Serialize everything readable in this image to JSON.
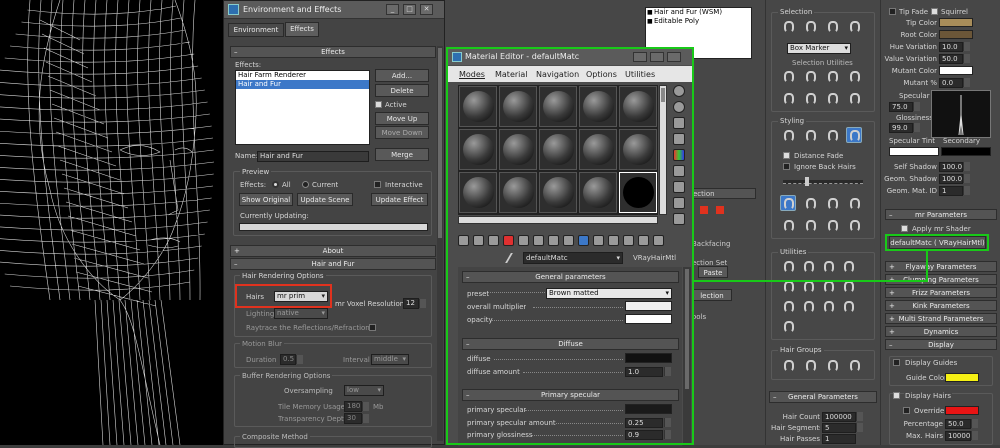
{
  "env": {
    "title": "Environment and Effects",
    "tabs": [
      "Environment",
      "Effects"
    ],
    "effects_rollout": "Effects",
    "effects_label": "Effects:",
    "effects_list": [
      "Hair Farm Renderer",
      "Hair and Fur"
    ],
    "add": "Add...",
    "delete": "Delete",
    "active": "Active",
    "move_up": "Move Up",
    "move_down": "Move Down",
    "name_label": "Name:",
    "name_value": "Hair and Fur",
    "merge": "Merge",
    "preview": "Preview",
    "effects_radio_label": "Effects:",
    "all": "All",
    "current": "Current",
    "interactive": "Interactive",
    "show_original": "Show Original",
    "update_scene": "Update Scene",
    "update_effect": "Update Effect",
    "currently_updating": "Currently Updating:",
    "about": "About",
    "hair_and_fur": "Hair and Fur",
    "hair_rendering_options": "Hair Rendering Options",
    "hairs_label": "Hairs",
    "hairs_value": "mr prim",
    "voxel_label": "mr Voxel Resolution",
    "voxel_value": "12",
    "lighting_label": "Lighting",
    "lighting_value": "native",
    "raytrace_label": "Raytrace the Reflections/Refractions",
    "motion_blur": "Motion Blur",
    "duration_label": "Duration",
    "duration_value": "0.5",
    "interval_label": "Interval",
    "interval_value": "middle",
    "buffer_options": "Buffer Rendering Options",
    "oversampling_label": "Oversampling",
    "oversampling_value": "low",
    "tile_memory_label": "Tile Memory Usage",
    "tile_memory_value": "180",
    "tile_memory_unit": "Mb",
    "transparency_label": "Transparency Depth",
    "transparency_value": "30",
    "composite_method": "Composite Method"
  },
  "mat": {
    "title": "Material Editor - defaultMatc",
    "menu": [
      "Modes",
      "Material",
      "Navigation",
      "Options",
      "Utilities"
    ],
    "material_name": "defaultMatc",
    "material_type": "VRayHairMtl",
    "general_parameters": "General parameters",
    "preset_label": "preset",
    "preset_value": "Brown matted",
    "overall_multiplier": "overall multiplier",
    "opacity": "opacity",
    "diffuse_header": "Diffuse",
    "diffuse": "diffuse",
    "diffuse_amount": "diffuse amount",
    "diffuse_amount_value": "1.0",
    "primary_specular_header": "Primary specular",
    "primary_specular": "primary specular",
    "primary_specular_amount": "primary specular amount",
    "primary_specular_amount_value": "0.25",
    "primary_glossiness": "primary glossiness",
    "primary_glossiness_value": "0.9"
  },
  "stack": {
    "items": [
      "Hair and Fur (WSM)",
      "Editable Poly"
    ]
  },
  "mid": {
    "selection": "Selection",
    "box_marker": "Box Marker",
    "selection_utilities": "Selection Utilities",
    "styling": "Styling",
    "distance_fade": "Distance Fade",
    "ignore_back_hairs": "Ignore Back Hairs",
    "utilities": "Utilities",
    "hair_groups": "Hair Groups",
    "general_parameters": "General Parameters",
    "hair_count_label": "Hair Count",
    "hair_count_value": "100000",
    "hair_segments_label": "Hair Segments",
    "hair_segments_value": "5",
    "hair_passes_label": "Hair Passes",
    "hair_passes_value": "1",
    "partial": [
      "ection",
      "Backfacing",
      "ection Set",
      "Paste",
      "lection",
      "ools"
    ]
  },
  "right": {
    "tip_fade": "Tip Fade",
    "squirrel": "Squirrel",
    "tip_color": "Tip Color",
    "root_color": "Root Color",
    "hue_variation_label": "Hue Variation",
    "hue_variation_value": "10.0",
    "value_variation_label": "Value Variation",
    "value_variation_value": "50.0",
    "mutant_color": "Mutant Color",
    "mutant_label": "Mutant %",
    "mutant_value": "0.0",
    "specular_label": "Specular",
    "specular_value": "75.0",
    "glossiness_label": "Glossiness",
    "glossiness_value": "99.0",
    "specular_tint": "Specular Tint",
    "secondary": "Secondary",
    "self_shadow_label": "Self Shadow",
    "self_shadow_value": "100.0",
    "geom_shadow_label": "Geom. Shadow",
    "geom_shadow_value": "100.0",
    "geom_mat_label": "Geom. Mat. ID",
    "geom_mat_value": "1",
    "mr_parameters": "mr Parameters",
    "apply_mr_shader": "Apply mr Shader",
    "shader_button": "defaultMatc  ( VRayHairMtl)",
    "rollouts": [
      "Flyaway Parameters",
      "Clumping Parameters",
      "Frizz Parameters",
      "Kink Parameters",
      "Multi Strand Parameters",
      "Dynamics",
      "Display"
    ],
    "display_guides": "Display Guides",
    "guide_color": "Guide Color",
    "display_hairs": "Display Hairs",
    "override": "Override",
    "percentage_label": "Percentage",
    "percentage_value": "50.0",
    "max_hairs_label": "Max. Hairs",
    "max_hairs_value": "10000"
  },
  "colors": {
    "highlight": "#18c918",
    "red_highlight": "#e0321e",
    "tip_color": "#a88d5a",
    "root_color": "#6b5638",
    "guide_color": "#f5f014",
    "override_color": "#e81414",
    "selection_blue": "#3c78c8"
  }
}
